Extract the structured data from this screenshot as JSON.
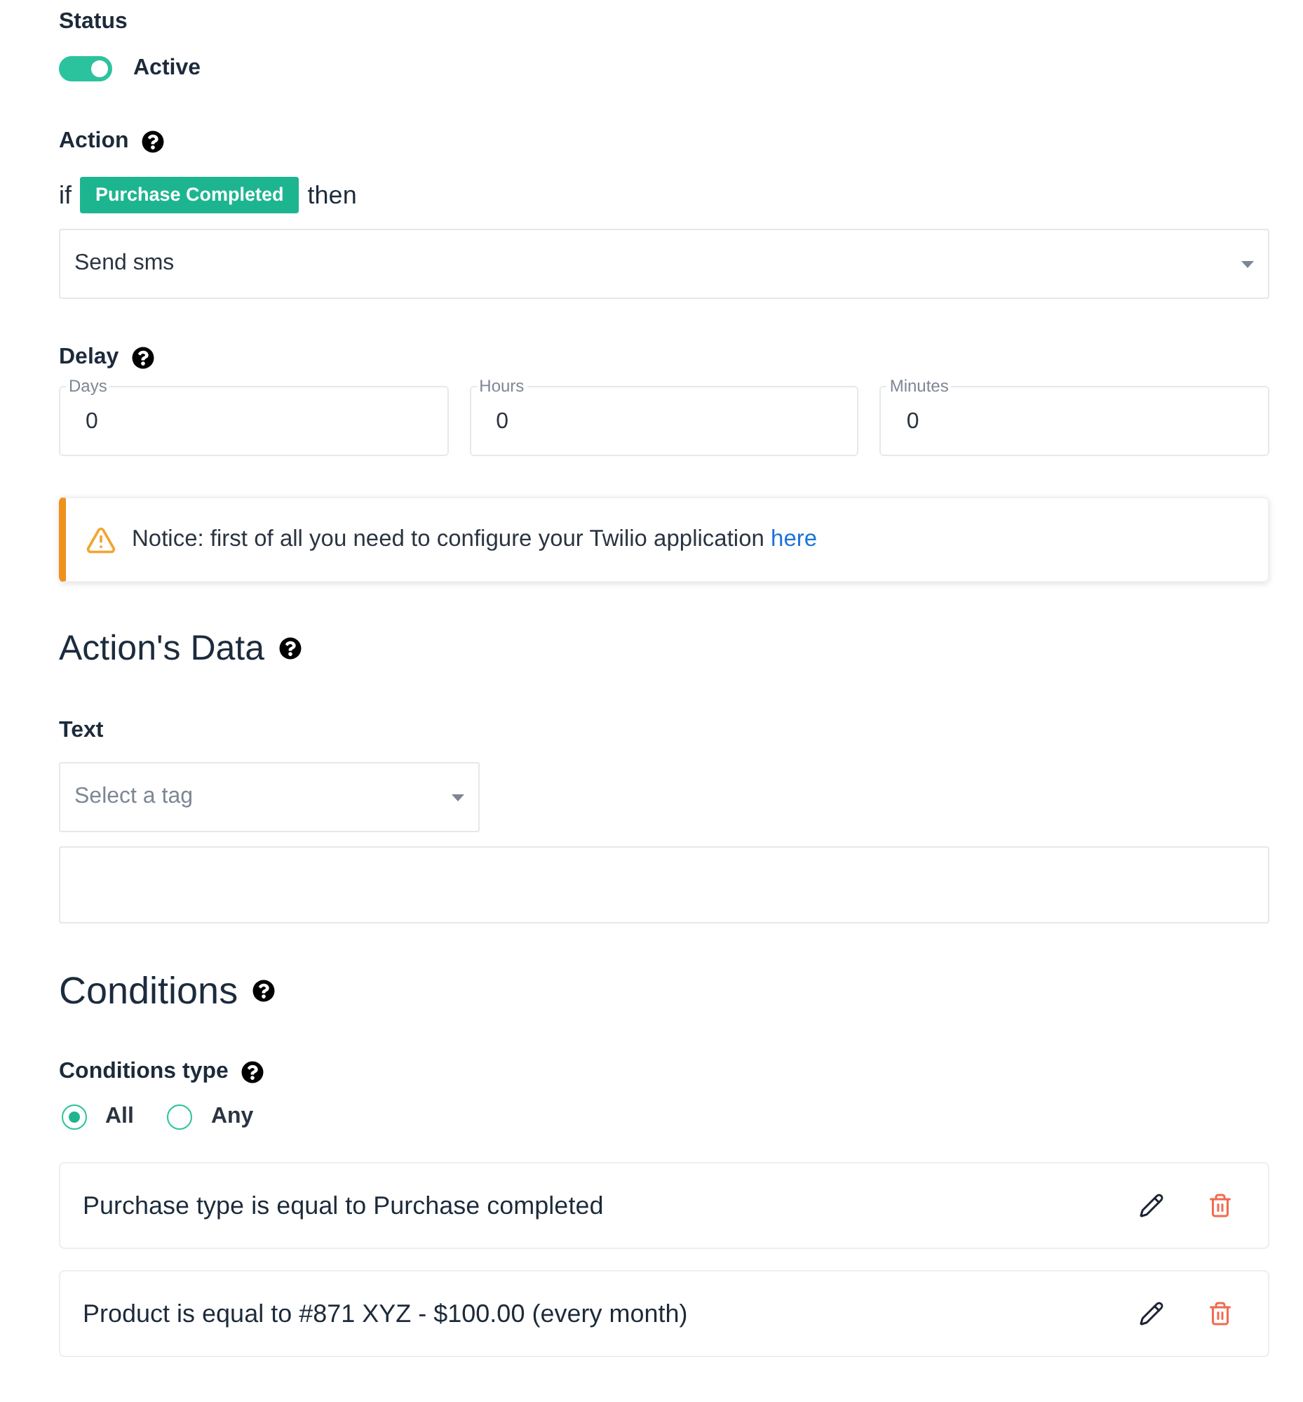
{
  "status": {
    "label": "Status",
    "toggle": {
      "on": true,
      "label": "Active"
    }
  },
  "action": {
    "label": "Action",
    "prefix": "if",
    "trigger": "Purchase Completed",
    "suffix": "then",
    "select": {
      "value": "Send sms"
    }
  },
  "delay": {
    "label": "Delay",
    "fields": [
      {
        "label": "Days",
        "value": "0"
      },
      {
        "label": "Hours",
        "value": "0"
      },
      {
        "label": "Minutes",
        "value": "0"
      }
    ]
  },
  "notice": {
    "text": "Notice: first of all you need to configure your Twilio application",
    "link": "here"
  },
  "actions_data": {
    "title": "Action's Data",
    "text_label": "Text",
    "tag_select": {
      "placeholder": "Select a tag"
    }
  },
  "conditions": {
    "title": "Conditions",
    "type_label": "Conditions type",
    "options": [
      {
        "label": "All",
        "selected": true
      },
      {
        "label": "Any",
        "selected": false
      }
    ],
    "items": [
      {
        "text": "Purchase type is equal to Purchase completed"
      },
      {
        "text": "Product is equal to #871 XYZ - $100.00 (every month)"
      }
    ]
  }
}
